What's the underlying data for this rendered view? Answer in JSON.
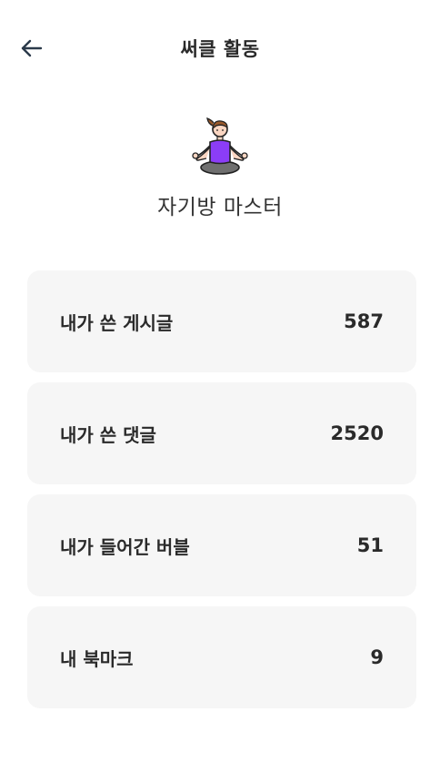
{
  "header": {
    "title": "써클 활동",
    "back_icon": "arrow-left-icon"
  },
  "profile": {
    "avatar_icon": "meditating-person-icon",
    "nickname": "자기방 마스터"
  },
  "stats": [
    {
      "label": "내가 쓴 게시글",
      "value": "587"
    },
    {
      "label": "내가 쓴 댓글",
      "value": "2520"
    },
    {
      "label": "내가 들어간 버블",
      "value": "51"
    },
    {
      "label": "내 북마크",
      "value": "9"
    }
  ],
  "colors": {
    "card_background": "#f6f6f6",
    "avatar_shirt": "#8b3df7",
    "text": "#2a2a2a"
  }
}
